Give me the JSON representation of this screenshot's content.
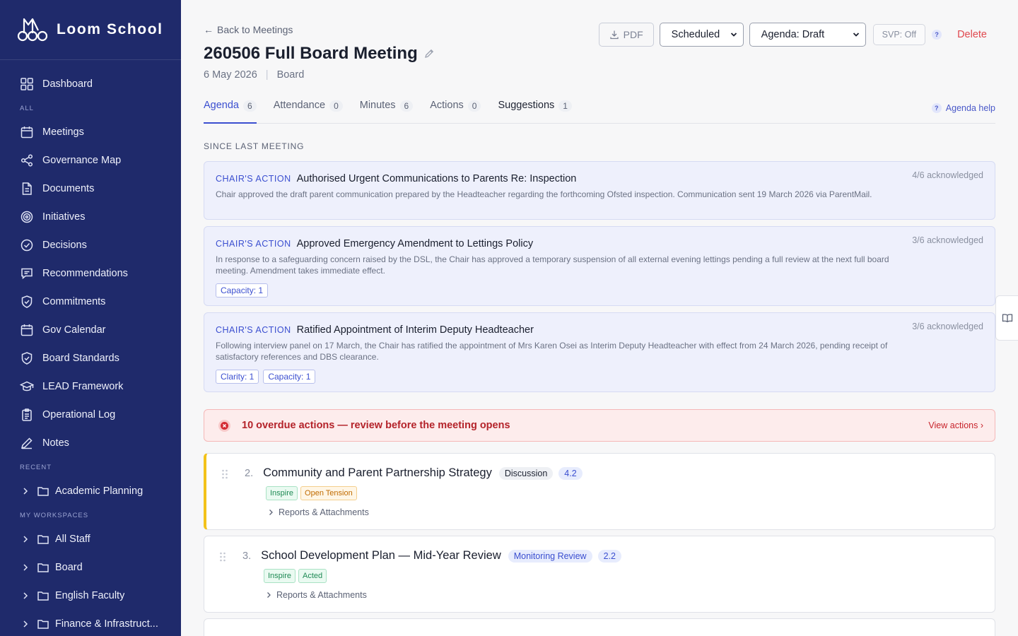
{
  "app": {
    "name": "Loom School"
  },
  "sidebar": {
    "items": [
      {
        "label": "Dashboard",
        "icon": "grid-icon"
      },
      {
        "label": "Meetings",
        "icon": "calendar-icon"
      },
      {
        "label": "Governance Map",
        "icon": "share-icon"
      },
      {
        "label": "Documents",
        "icon": "document-icon"
      },
      {
        "label": "Initiatives",
        "icon": "target-icon"
      },
      {
        "label": "Decisions",
        "icon": "check-circle-icon"
      },
      {
        "label": "Recommendations",
        "icon": "message-icon"
      },
      {
        "label": "Commitments",
        "icon": "shield-check-icon"
      },
      {
        "label": "Gov Calendar",
        "icon": "calendar-icon"
      },
      {
        "label": "Board Standards",
        "icon": "shield-check-icon"
      },
      {
        "label": "LEAD Framework",
        "icon": "graduation-cap-icon"
      },
      {
        "label": "Operational Log",
        "icon": "clipboard-icon"
      },
      {
        "label": "Notes",
        "icon": "pen-icon"
      }
    ],
    "section_all": "ALL",
    "section_recent": "RECENT",
    "section_workspaces": "MY WORKSPACES",
    "recent": [
      {
        "label": "Academic Planning"
      }
    ],
    "workspaces": [
      {
        "label": "All Staff"
      },
      {
        "label": "Board"
      },
      {
        "label": "English Faculty"
      },
      {
        "label": "Finance & Infrastruct..."
      }
    ]
  },
  "header": {
    "back_label": "Back to Meetings",
    "title": "260506 Full Board Meeting",
    "date": "6 May 2026",
    "body": "Board",
    "pdf_label": "PDF",
    "status_value": "Scheduled",
    "agenda_value": "Agenda: Draft",
    "svp_label": "SVP: Off",
    "help_glyph": "?",
    "delete_label": "Delete"
  },
  "tabs": [
    {
      "label": "Agenda",
      "count": "6"
    },
    {
      "label": "Attendance",
      "count": "0"
    },
    {
      "label": "Minutes",
      "count": "6"
    },
    {
      "label": "Actions",
      "count": "0"
    },
    {
      "label": "Suggestions",
      "count": "1"
    }
  ],
  "agenda_help": "Agenda help",
  "since_last_meeting": {
    "label": "SINCE LAST MEETING",
    "cards": [
      {
        "tag": "CHAIR'S ACTION",
        "title": "Authorised Urgent Communications to Parents Re: Inspection",
        "ack": "4/6 acknowledged",
        "body": "Chair approved the draft parent communication prepared by the Headteacher regarding the forthcoming Ofsted inspection. Communication sent 19 March 2026 via ParentMail.",
        "tags": []
      },
      {
        "tag": "CHAIR'S ACTION",
        "title": "Approved Emergency Amendment to Lettings Policy",
        "ack": "3/6 acknowledged",
        "body": "In response to a safeguarding concern raised by the DSL, the Chair has approved a temporary suspension of all external evening lettings pending a full review at the next full board meeting. Amendment takes immediate effect.",
        "tags": [
          "Capacity: 1"
        ]
      },
      {
        "tag": "CHAIR'S ACTION",
        "title": "Ratified Appointment of Interim Deputy Headteacher",
        "ack": "3/6 acknowledged",
        "body": "Following interview panel on 17 March, the Chair has ratified the appointment of Mrs Karen Osei as Interim Deputy Headteacher with effect from 24 March 2026, pending receipt of satisfactory references and DBS clearance.",
        "tags": [
          "Clarity: 1",
          "Capacity: 1"
        ]
      }
    ]
  },
  "overdue": {
    "text": "10 overdue actions — review before the meeting opens",
    "link": "View actions ›"
  },
  "agenda_items": [
    {
      "number": "2.",
      "title": "Community and Parent Partnership Strategy",
      "type": "Discussion",
      "ref": "4.2",
      "tags": [
        "Inspire",
        "Open Tension"
      ],
      "reports": "Reports & Attachments"
    },
    {
      "number": "3.",
      "title": "School Development Plan — Mid-Year Review",
      "type": "Monitoring Review",
      "ref": "2.2",
      "tags": [
        "Inspire",
        "Acted"
      ],
      "reports": "Reports & Attachments"
    }
  ],
  "colors": {
    "sidebar_bg": "#1f2a6b",
    "accent": "#3b4fd0",
    "danger": "#e0484e",
    "flag": "#f3c21a"
  }
}
